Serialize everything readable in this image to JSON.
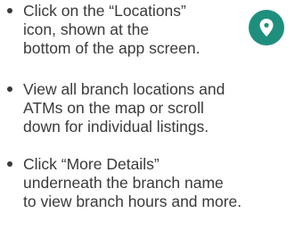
{
  "instructions": [
    {
      "lines": [
        "Click on the “Locations”",
        "icon, shown at the",
        "bottom of the app screen."
      ]
    },
    {
      "lines": [
        "View all branch locations and",
        "ATMs on the map or scroll",
        "down for individual listings."
      ]
    },
    {
      "lines": [
        "Click “More Details”",
        "underneath the branch name",
        "to view branch hours and more."
      ]
    }
  ],
  "locations_icon": {
    "name": "location-pin-icon",
    "background_color": "#1f8f7d",
    "foreground_color": "#ffffff"
  }
}
